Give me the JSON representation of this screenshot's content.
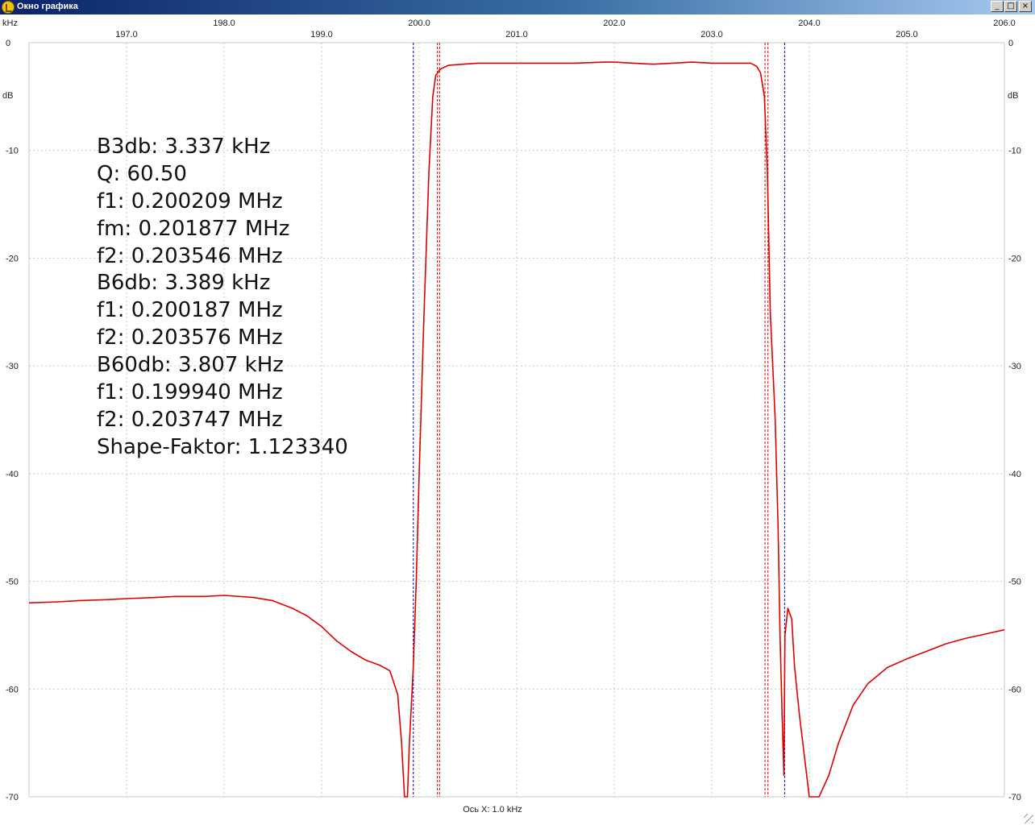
{
  "window": {
    "title": "Окно графика",
    "minimize_glyph": "_",
    "maximize_glyph": "□",
    "close_glyph": "×"
  },
  "chart_data": {
    "type": "line",
    "x_unit_label": "kHz",
    "y_unit_label": "dB",
    "x_axis_caption": "Ось X: 1.0 kHz",
    "xlim": [
      196.0,
      206.0
    ],
    "ylim": [
      -70,
      0
    ],
    "x_ticks": [
      197.0,
      198.0,
      199.0,
      200.0,
      201.0,
      202.0,
      203.0,
      204.0,
      205.0,
      206.0
    ],
    "x_tick_labels": [
      "197.0",
      "198.0",
      "199.0",
      "200.0",
      "201.0",
      "202.0",
      "203.0",
      "204.0",
      "205.0",
      "206.0"
    ],
    "y_ticks": [
      0,
      -10,
      -20,
      -30,
      -40,
      -50,
      -60,
      -70
    ],
    "y_tick_labels": [
      "0",
      "-10",
      "-20",
      "-30",
      "-40",
      "-50",
      "-60",
      "-70"
    ],
    "grid": true,
    "series": [
      {
        "color": "#e00000",
        "x": [
          196.0,
          196.3,
          196.5,
          196.8,
          197.0,
          197.3,
          197.5,
          197.8,
          198.0,
          198.3,
          198.5,
          198.7,
          198.85,
          199.0,
          199.15,
          199.3,
          199.45,
          199.6,
          199.7,
          199.78,
          199.82,
          199.85,
          199.88,
          199.9,
          199.94,
          199.97,
          200.0,
          200.05,
          200.1,
          200.14,
          200.17,
          200.19,
          200.21,
          200.25,
          200.3,
          200.45,
          200.6,
          200.8,
          201.0,
          201.3,
          201.6,
          201.9,
          202.0,
          202.2,
          202.4,
          202.6,
          202.8,
          203.0,
          203.2,
          203.4,
          203.46,
          203.5,
          203.54,
          203.57,
          203.6,
          203.65,
          203.68,
          203.7,
          203.72,
          203.73,
          203.74,
          203.75,
          203.78,
          203.82,
          203.85,
          203.9,
          204.0,
          204.05,
          204.1,
          204.2,
          204.3,
          204.45,
          204.6,
          204.8,
          205.0,
          205.2,
          205.4,
          205.6,
          205.8,
          206.0
        ],
        "y": [
          -52.0,
          -51.9,
          -51.8,
          -51.7,
          -51.6,
          -51.5,
          -51.4,
          -51.4,
          -51.3,
          -51.5,
          -51.8,
          -52.5,
          -53.2,
          -54.2,
          -55.5,
          -56.5,
          -57.3,
          -57.8,
          -58.3,
          -60.5,
          -65.0,
          -70.0,
          -70.0,
          -65.0,
          -58.0,
          -50.0,
          -40.0,
          -25.0,
          -12.0,
          -5.0,
          -3.0,
          -2.8,
          -2.5,
          -2.3,
          -2.1,
          -2.0,
          -1.9,
          -1.9,
          -1.9,
          -1.9,
          -1.9,
          -1.8,
          -1.8,
          -1.9,
          -2.0,
          -1.9,
          -1.8,
          -1.9,
          -1.9,
          -1.9,
          -2.2,
          -2.8,
          -5.0,
          -12.0,
          -25.0,
          -35.0,
          -45.0,
          -55.0,
          -62.0,
          -65.0,
          -68.0,
          -55.0,
          -52.5,
          -53.5,
          -58.0,
          -62.5,
          -70.0,
          -70.0,
          -70.0,
          -68.0,
          -65.0,
          -61.5,
          -59.5,
          -58.0,
          -57.2,
          -56.5,
          -55.8,
          -55.3,
          -54.9,
          -54.5
        ]
      }
    ],
    "markers": [
      {
        "color": "#0000cc",
        "x": 199.94
      },
      {
        "color": "#e00000",
        "x": 200.187
      },
      {
        "color": "#e00000",
        "x": 200.209
      },
      {
        "color": "#e00000",
        "x": 203.546
      },
      {
        "color": "#e00000",
        "x": 203.576
      },
      {
        "color": "#0000cc",
        "x": 203.747
      }
    ],
    "annotations": [
      "B3db: 3.337 kHz",
      "Q: 60.50",
      "f1: 0.200209 MHz",
      "fm: 0.201877 MHz",
      "f2: 0.203546 MHz",
      "B6db: 3.389 kHz",
      "f1: 0.200187 MHz",
      "f2: 0.203576 MHz",
      "B60db: 3.807 kHz",
      "f1: 0.199940 MHz",
      "f2: 0.203747 MHz",
      "Shape-Faktor: 1.123340"
    ]
  }
}
